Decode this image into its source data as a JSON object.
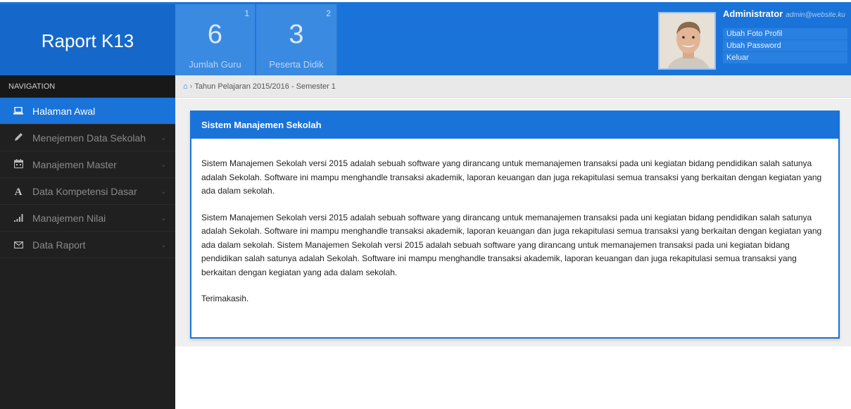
{
  "brand": {
    "title": "Raport K13"
  },
  "stats": [
    {
      "index": "1",
      "value": "6",
      "label": "Jumlah Guru"
    },
    {
      "index": "2",
      "value": "3",
      "label": "Peserta Didik"
    }
  ],
  "user": {
    "name": "Administrator",
    "email": "admin@website.ku",
    "menu": [
      "Ubah Foto Profil",
      "Ubah Password",
      "Keluar"
    ]
  },
  "sidebar": {
    "title": "NAVIGATION",
    "items": [
      {
        "label": "Halaman Awal",
        "icon": "laptop-icon",
        "active": true
      },
      {
        "label": "Menejemen Data Sekolah",
        "icon": "pencil-icon"
      },
      {
        "label": "Manajemen Master",
        "icon": "calendar-icon"
      },
      {
        "label": "Data Kompetensi Dasar",
        "icon": "font-icon"
      },
      {
        "label": "Manajemen Nilai",
        "icon": "signal-icon"
      },
      {
        "label": "Data Raport",
        "icon": "envelope-icon"
      }
    ]
  },
  "breadcrumb": {
    "text": "Tahun Pelajaran 2015/2016 - Semester 1"
  },
  "panel": {
    "title": "Sistem Manajemen Sekolah",
    "paragraphs": [
      "Sistem Manajemen Sekolah versi 2015 adalah sebuah software yang dirancang untuk memanajemen transaksi pada uni kegiatan bidang pendidikan salah satunya adalah Sekolah. Software ini mampu menghandle transaksi akademik, laporan keuangan dan juga rekapitulasi semua transaksi yang berkaitan dengan kegiatan yang ada dalam sekolah.",
      "Sistem Manajemen Sekolah versi 2015 adalah sebuah software yang dirancang untuk memanajemen transaksi pada uni kegiatan bidang pendidikan salah satunya adalah Sekolah. Software ini mampu menghandle transaksi akademik, laporan keuangan dan juga rekapitulasi semua transaksi yang berkaitan dengan kegiatan yang ada dalam sekolah. Sistem Manajemen Sekolah versi 2015 adalah sebuah software yang dirancang untuk memanajemen transaksi pada uni kegiatan bidang pendidikan salah satunya adalah Sekolah. Software ini mampu menghandle transaksi akademik, laporan keuangan dan juga rekapitulasi semua transaksi yang berkaitan dengan kegiatan yang ada dalam sekolah.",
      "Terimakasih."
    ]
  },
  "colors": {
    "primary": "#1a73d9",
    "sidebar": "#202020",
    "breadcrumb": "#e9e9e9"
  }
}
